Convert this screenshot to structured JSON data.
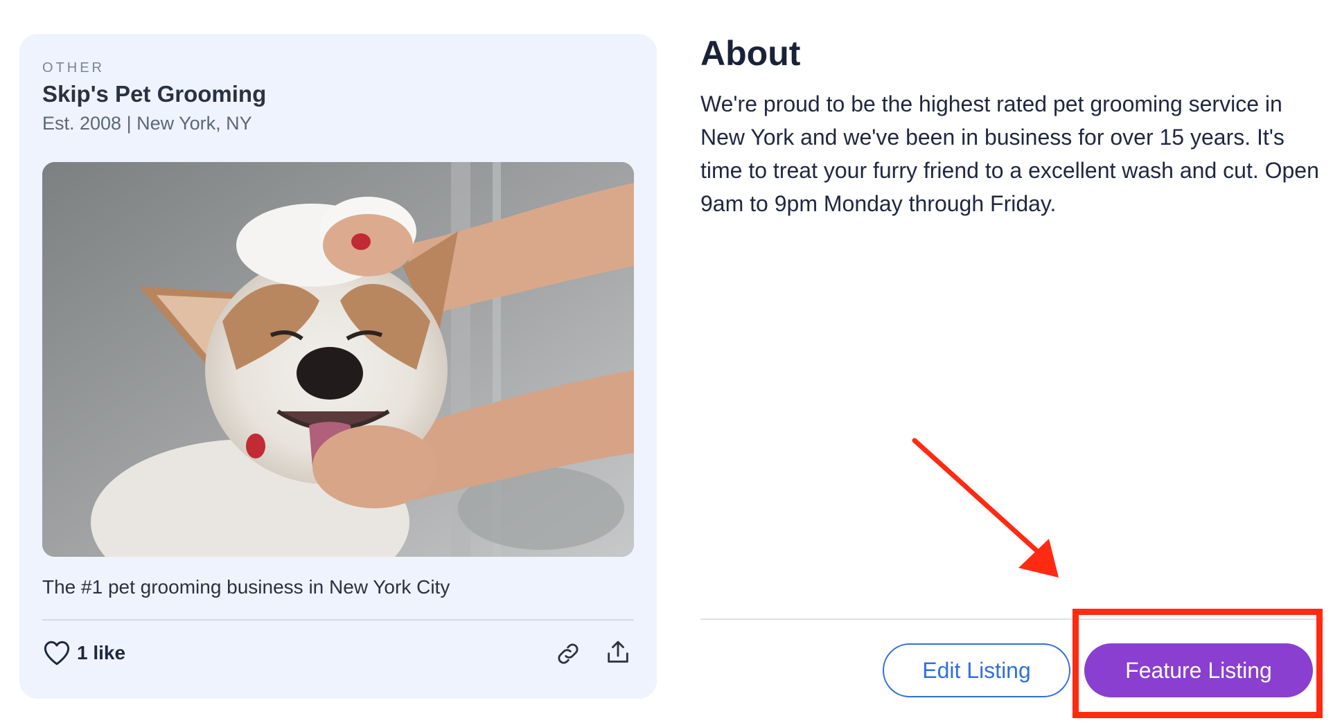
{
  "card": {
    "category": "OTHER",
    "name": "Skip's Pet Grooming",
    "meta": "Est. 2008 | New York, NY",
    "image_alt": "Corgi getting shampooed",
    "tagline": "The #1 pet grooming business in New York City",
    "likes_label": "1 like"
  },
  "about": {
    "title": "About",
    "description": "We're proud to be the highest rated pet grooming service in New York and we've been in business for over 15 years. It's time to treat your furry friend to a excellent wash and cut. Open 9am to 9pm Monday through Friday."
  },
  "actions": {
    "edit_label": "Edit Listing",
    "feature_label": "Feature Listing"
  },
  "icons": {
    "like": "heart-icon",
    "copy_link": "link-icon",
    "share": "share-icon"
  },
  "colors": {
    "card_background": "#eef3fd",
    "primary_blue": "#2f6fe0",
    "feature_purple": "#8a3fd0",
    "annotation_red": "#ff2a12"
  }
}
